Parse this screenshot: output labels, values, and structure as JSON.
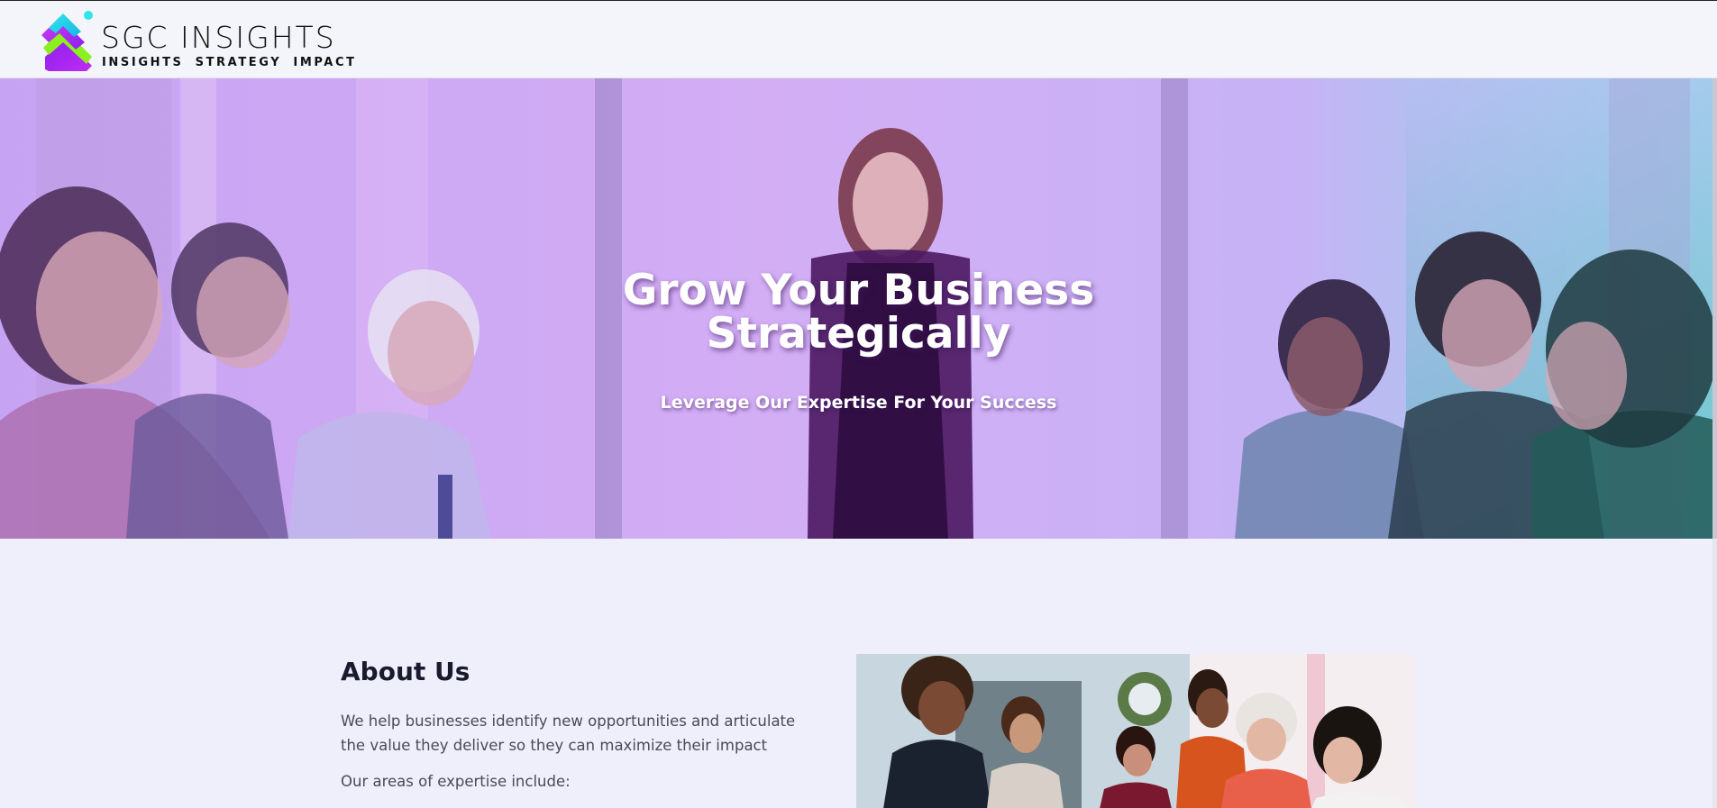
{
  "header": {
    "logo_title": "SGC INSIGHTS",
    "logo_tagline": "INSIGHTS  STRATEGY  IMPACT",
    "logo_icon": "stacked-chevrons-icon",
    "colors": {
      "teal": "#2ee6e6",
      "purple": "#8a1ff0",
      "lime": "#8cf01e",
      "pink": "#d23cf0"
    }
  },
  "hero": {
    "title_line1": "Grow Your Business",
    "title_line2": "Strategically",
    "subtitle": "Leverage Our Expertise For Your Success",
    "overlay_colors": [
      "#c9a6f7",
      "#d6b1f4",
      "#7fe0e0"
    ]
  },
  "about": {
    "heading": "About Us",
    "body": "We help businesses identify new opportunities and articulate the value they deliver so they can maximize their impact",
    "areas_intro": "Our areas of expertise include:"
  }
}
